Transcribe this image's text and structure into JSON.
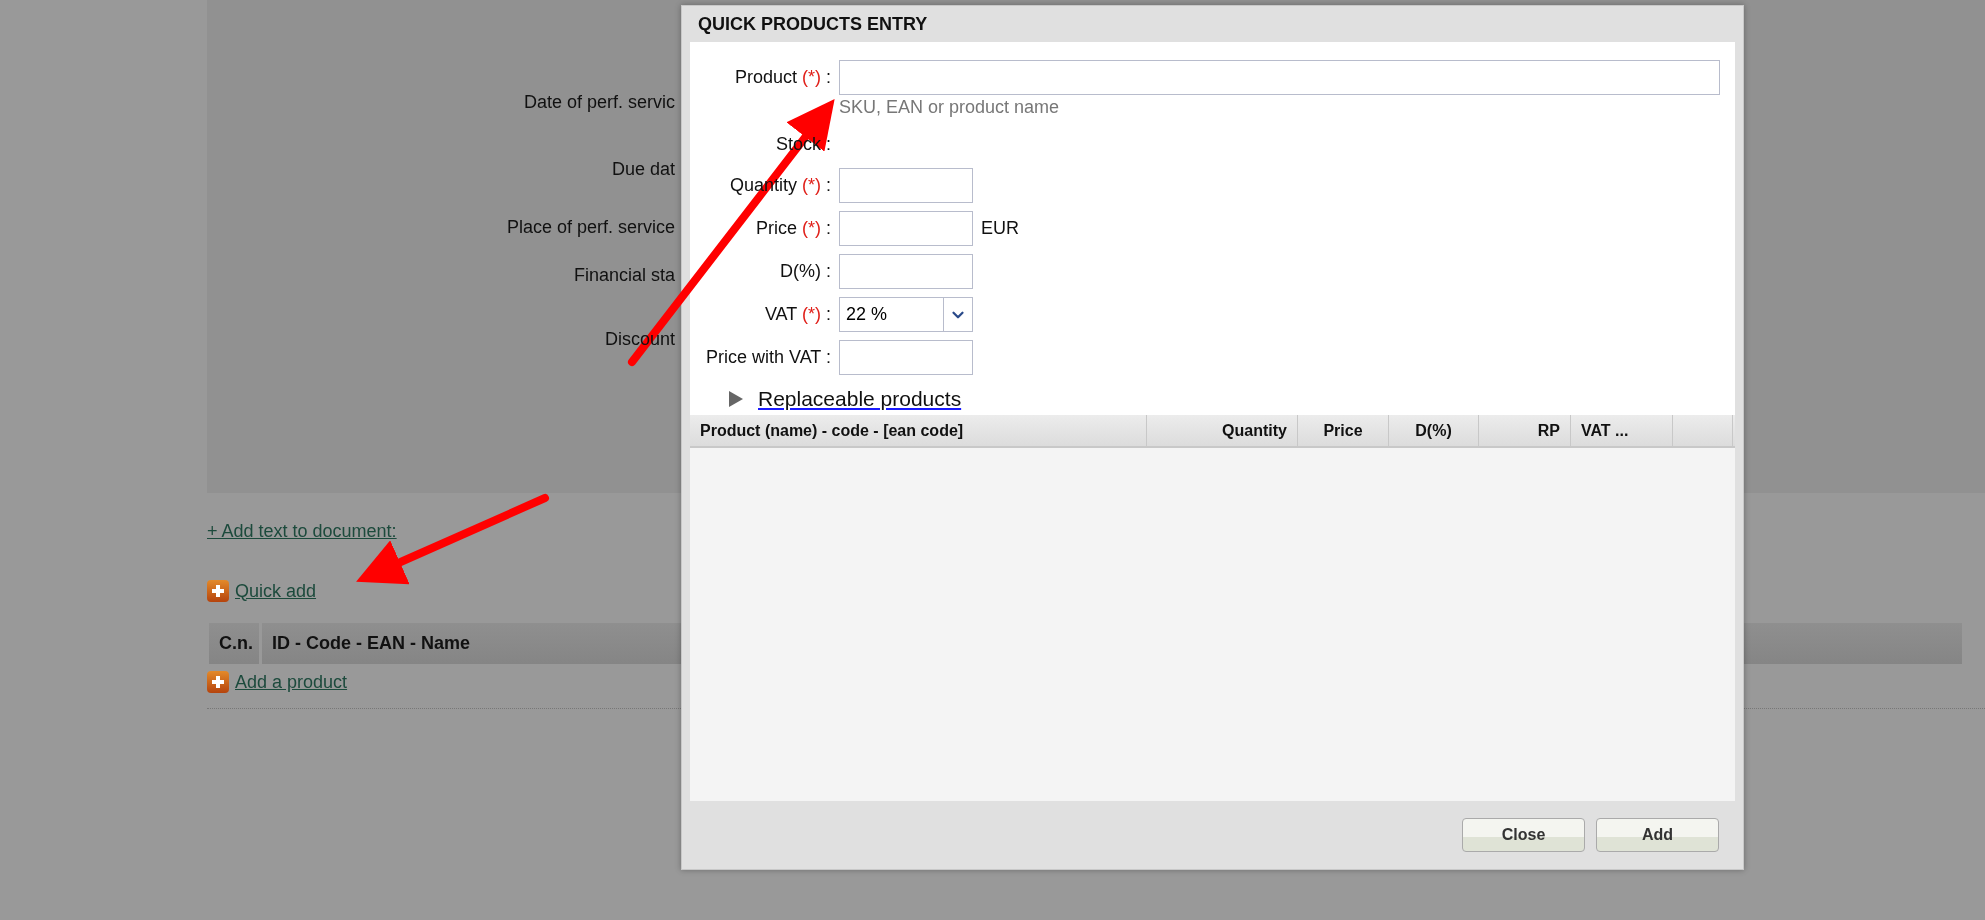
{
  "background_form": {
    "fields": [
      {
        "label": "Date of perf. servic"
      },
      {
        "label": "Due dat"
      },
      {
        "label": "Place of perf. service"
      },
      {
        "label": "Financial sta"
      },
      {
        "label": "Discount"
      }
    ]
  },
  "add_text_link": "+ Add text to document:",
  "quick_add_link": "Quick add",
  "products_table": {
    "columns": [
      "C.n.",
      "ID - Code - EAN - Name"
    ]
  },
  "add_product_link": "Add a product",
  "dialog": {
    "title": "QUICK PRODUCTS ENTRY",
    "fields": [
      {
        "kind": "wide_text",
        "label": "Product",
        "mark": "(*)",
        "sep": ":",
        "hint": "SKU, EAN or product name"
      },
      {
        "kind": "plain",
        "label": "Stock",
        "sep": ":"
      },
      {
        "kind": "text",
        "label": "Quantity",
        "mark": "(*)",
        "sep": ":"
      },
      {
        "kind": "text",
        "label": "Price",
        "mark": "(*)",
        "sep": ":",
        "unit": "EUR"
      },
      {
        "kind": "text",
        "label": "D(%)",
        "sep": ":"
      },
      {
        "kind": "select",
        "label": "VAT",
        "mark": "(*)",
        "sep": ":",
        "value": "22 %"
      },
      {
        "kind": "text",
        "label": "Price with VAT",
        "sep": ":"
      }
    ],
    "replaceable": {
      "label": "Replaceable products",
      "expanded": false
    },
    "table": {
      "columns": [
        {
          "label": "Product (name) - code - [ean code]"
        },
        {
          "label": "Quantity"
        },
        {
          "label": "Price"
        },
        {
          "label": "D(%)"
        },
        {
          "label": "RP"
        },
        {
          "label": "VAT ..."
        }
      ]
    },
    "buttons": [
      "Close",
      "Add"
    ]
  }
}
